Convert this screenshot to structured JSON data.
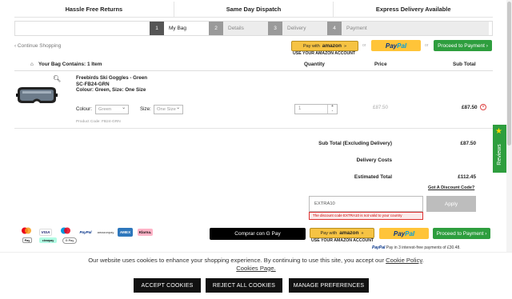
{
  "benefits": [
    "Hassle Free Returns",
    "Same Day Dispatch",
    "Express Delivery Available"
  ],
  "steps": [
    {
      "num": "1",
      "label": "My Bag"
    },
    {
      "num": "2",
      "label": "Details"
    },
    {
      "num": "3",
      "label": "Delivery"
    },
    {
      "num": "4",
      "label": "Payment"
    }
  ],
  "nav": {
    "continue": "‹ Continue Shopping"
  },
  "amazon": {
    "pay_with": "Pay with",
    "brand": "amazon",
    "caption": "USE YOUR AMAZON ACCOUNT"
  },
  "or_label": "or",
  "paypal": {
    "p1": "Pay",
    "p2": "Pal"
  },
  "proceed_label": "Proceed to Payment ›",
  "bag": {
    "title": "Your Bag Contains: 1 Item",
    "col_qty": "Quantity",
    "col_price": "Price",
    "col_subtotal": "Sub Total"
  },
  "item": {
    "name": "Freebirds Ski Goggles - Green",
    "sku": "SC-FB24-GRN",
    "desc": "Colour: Green, Size: One Size",
    "colour_label": "Colour:",
    "colour_value": "Green",
    "size_label": "Size:",
    "size_value": "One Size",
    "code": "Product Code: FB24-GRN",
    "qty": "1",
    "qty_plus": "+",
    "qty_minus": "-",
    "price": "£87.50",
    "subtotal": "£87.50",
    "remove": "×"
  },
  "totals": {
    "subtotal_label": "Sub Total (Excluding Delivery)",
    "subtotal_value": "£87.50",
    "delivery_label": "Delivery Costs",
    "delivery_value": "",
    "estimated_label": "Estimated Total",
    "estimated_value": "£112.45",
    "discount_link": "Got A Discount Code?"
  },
  "discount": {
    "value": "EXTRA10",
    "error": "The discount code EXTRA10 is not valid to your country",
    "apply": "Apply"
  },
  "payment_icons": [
    {
      "name": "mastercard-icon",
      "label": ""
    },
    {
      "name": "visa-icon",
      "label": "VISA"
    },
    {
      "name": "maestro-icon",
      "label": ""
    },
    {
      "name": "paypal-small-icon",
      "label": "PayPal"
    },
    {
      "name": "amazonpay-icon",
      "label": "amazonpay"
    },
    {
      "name": "amex-icon",
      "label": "AMEX"
    },
    {
      "name": "klarna-icon",
      "label": "Klarna."
    },
    {
      "name": "applepay-icon",
      "label": "Pay"
    },
    {
      "name": "clearpay-icon",
      "label": "clearpay"
    },
    {
      "name": "googlepay-icon",
      "label": "G Pay"
    }
  ],
  "gpay_label": "Comprar con G Pay",
  "paypal_later": {
    "brand": "PayPal",
    "text": "Pay in 3 interest-free payments of £30.48."
  },
  "cookie": {
    "text": "Our website uses cookies to enhance your shopping experience. By continuing to use this site, you accept our",
    "policy_link": "Cookie Policy",
    "pages_link": "Cookies Page.",
    "accept": "ACCEPT COOKIES",
    "reject": "REJECT ALL COOKIES",
    "manage": "MANAGE PREFERENCES"
  },
  "reviews_label": "Reviews",
  "colors": {
    "green": "#2e9e3e",
    "paypal_yellow": "#ffc439",
    "amazon_yellow": "#f6c343",
    "error_red": "#c00"
  }
}
